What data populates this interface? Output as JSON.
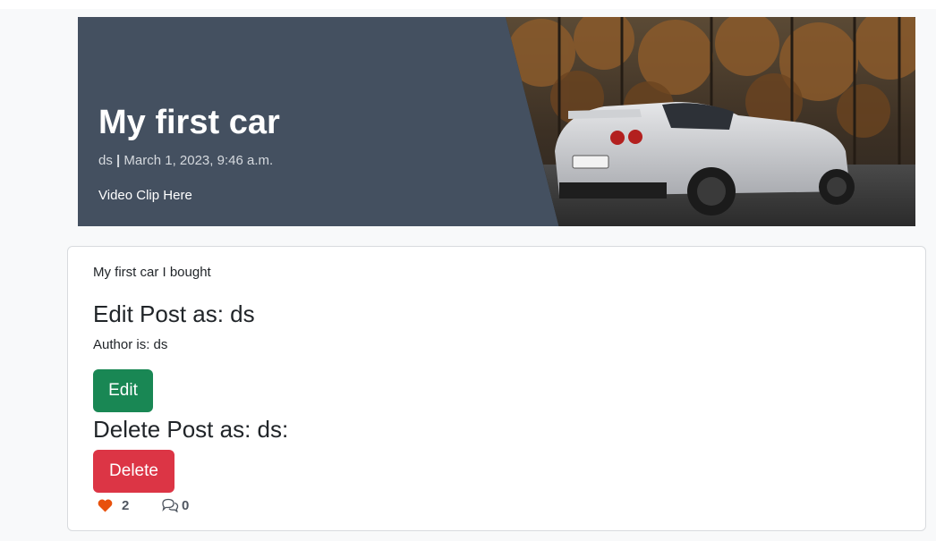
{
  "post": {
    "title": "My first car",
    "author": "ds",
    "separator": "|",
    "date": "March 1, 2023, 9:46 a.m.",
    "video_text": "Video Clip Here",
    "content": "My first car I bought"
  },
  "actions": {
    "edit_heading": "Edit Post as: ds",
    "author_line": "Author is: ds",
    "edit_label": "Edit",
    "delete_heading": "Delete Post as: ds:",
    "delete_label": "Delete"
  },
  "stats": {
    "likes": "2",
    "comments": "0"
  },
  "icons": {
    "like": "heart-icon",
    "comments": "comment-icon"
  },
  "colors": {
    "masthead": "#445060",
    "edit_button": "#198754",
    "delete_button": "#dc3545",
    "heart": "#e8510c"
  }
}
